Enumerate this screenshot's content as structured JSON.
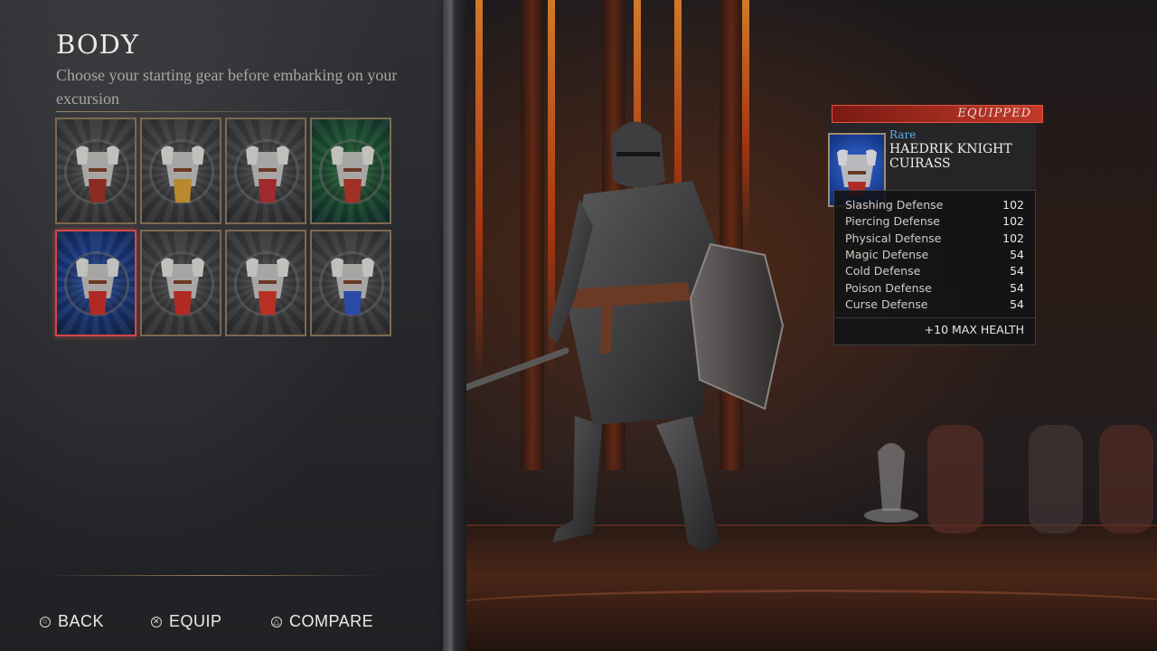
{
  "header": {
    "title": "BODY",
    "subtitle": "Choose your starting gear before embarking on your excursion"
  },
  "gear_grid": {
    "selected_index": 4,
    "slots": [
      {
        "icon": "red-leather-armor-icon",
        "bg": "#4a4b4d",
        "accent": "#8c2a24"
      },
      {
        "icon": "gold-trim-armor-icon",
        "bg": "#4a4b4d",
        "accent": "#b8892e"
      },
      {
        "icon": "crimson-cloak-armor-icon",
        "bg": "#4a4b4d",
        "accent": "#a02a2e"
      },
      {
        "icon": "green-ornate-armor-icon",
        "bg": "#1e6b2e",
        "accent": "#a03024"
      },
      {
        "icon": "haedrik-knight-cuirass-icon",
        "bg": "#1b46a8",
        "accent": "#b02a24"
      },
      {
        "icon": "steel-tabard-armor-icon",
        "bg": "#4a4b4d",
        "accent": "#b02a24"
      },
      {
        "icon": "red-tabard-armor-icon",
        "bg": "#4a4b4d",
        "accent": "#b83024"
      },
      {
        "icon": "blue-tabard-armor-icon",
        "bg": "#4a4b4d",
        "accent": "#2a4aa8"
      }
    ]
  },
  "controls": {
    "back": {
      "glyph": "circle-button-icon",
      "symbol": "○",
      "label": "BACK"
    },
    "equip": {
      "glyph": "cross-button-icon",
      "symbol": "✕",
      "label": "EQUIP"
    },
    "compare": {
      "glyph": "triangle-button-icon",
      "symbol": "△",
      "label": "COMPARE"
    }
  },
  "item_card": {
    "status": "EQUIPPED",
    "rarity": "Rare",
    "rarity_color": "#5aaeea",
    "name": "HAEDRIK KNIGHT CUIRASS",
    "stats": [
      {
        "label": "Slashing Defense",
        "value": "102"
      },
      {
        "label": "Piercing Defense",
        "value": "102"
      },
      {
        "label": "Physical Defense",
        "value": "102"
      },
      {
        "label": "Magic Defense",
        "value": "54"
      },
      {
        "label": "Cold Defense",
        "value": "54"
      },
      {
        "label": "Poison Defense",
        "value": "54"
      },
      {
        "label": "Curse Defense",
        "value": "54"
      }
    ],
    "bonus": "+10 MAX HEALTH"
  },
  "colors": {
    "selected_border": "#d24848",
    "slot_border": "#7d6a52",
    "equipped_banner": "#c23a2a"
  }
}
